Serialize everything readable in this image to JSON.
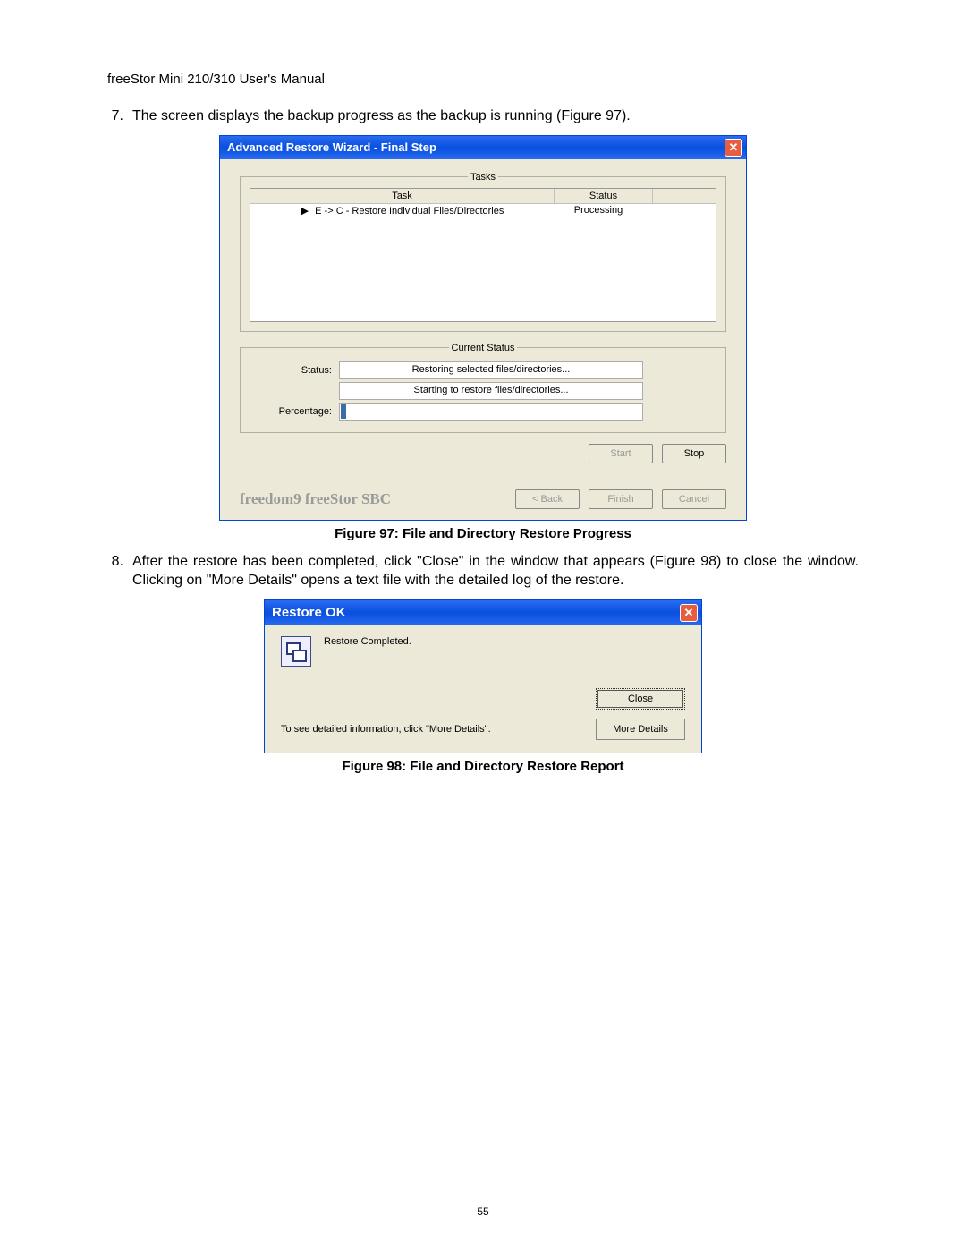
{
  "manual_header": "freeStor Mini 210/310 User's Manual",
  "step7": {
    "num": "7.",
    "text": "The screen displays the backup progress as the backup is running (Figure 97)."
  },
  "wizard": {
    "title": "Advanced Restore Wizard - Final Step",
    "tasks_legend": "Tasks",
    "th_task": "Task",
    "th_status": "Status",
    "row_arrow": "▶",
    "row_task": "E -> C - Restore Individual Files/Directories",
    "row_status": "Processing",
    "cs_legend": "Current Status",
    "status_label": "Status:",
    "status_value": "Restoring selected files/directories...",
    "status_value2": "Starting to restore files/directories...",
    "percent_label": "Percentage:",
    "start_btn": "Start",
    "stop_btn": "Stop",
    "brand": "freedom9 freeStor SBC",
    "back_btn": "< Back",
    "finish_btn": "Finish",
    "cancel_btn": "Cancel"
  },
  "caption97": "Figure 97: File and Directory Restore Progress",
  "step8": {
    "num": "8.",
    "text": "After the restore has been completed, click \"Close\" in the window that appears (Figure 98) to close the window.  Clicking on \"More Details\" opens a text file with the detailed log of the restore."
  },
  "dlg": {
    "title": "Restore OK",
    "msg": "Restore Completed.",
    "close_btn": "Close",
    "hint": "To see detailed information, click \"More Details\".",
    "more_btn": "More Details"
  },
  "caption98": "Figure 98: File and Directory Restore Report",
  "page_number": "55"
}
